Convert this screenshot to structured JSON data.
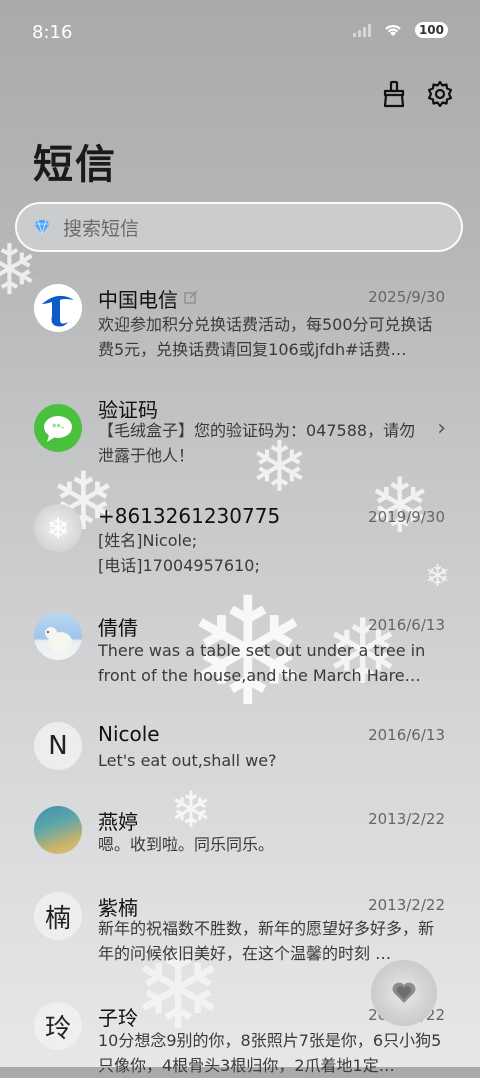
{
  "status": {
    "time": "8:16",
    "battery": "100"
  },
  "header": {
    "title": "短信"
  },
  "search": {
    "placeholder": "搜索短信"
  },
  "messages": [
    {
      "name": "中国电信",
      "date": "2025/9/30",
      "snippet": "欢迎参加积分兑换话费活动，每500分可兑换话费5元，兑换话费请回复106或jfdh#话费…",
      "avatar": "telecom-logo"
    },
    {
      "name": "验证码",
      "date": "",
      "snippet": "【毛绒盒子】您的验证码为：047588，请勿泄露于他人！",
      "avatar": "message-bubble"
    },
    {
      "name": "+8613261230775",
      "date": "2019/9/30",
      "snippet": "[姓名]Nicole;\n[电话]17004957610;",
      "avatar": "snowflake-photo"
    },
    {
      "name": "倩倩",
      "date": "2016/6/13",
      "snippet": "There was a table set out under a tree in front of the house,and the March Hare an…",
      "avatar": "polar-bear-photo"
    },
    {
      "name": "Nicole",
      "date": "2016/6/13",
      "snippet": "Let's eat out,shall we?",
      "avatar_letter": "N"
    },
    {
      "name": "燕婷",
      "date": "2013/2/22",
      "snippet": "嗯。收到啦。同乐同乐。",
      "avatar": "landscape-photo"
    },
    {
      "name": "紫楠",
      "date": "2013/2/22",
      "snippet": "新年的祝福数不胜数，新年的愿望好多好多，新年的问候依旧美好，在这个温馨的时刻 …",
      "avatar_letter": "楠"
    },
    {
      "name": "子玲",
      "date": "2013/2/22",
      "snippet": "10分想念9别的你，8张照片7张是你，6只小狗5只像你，4根骨头3根归你，2爪着地1定…",
      "avatar_letter": "玲"
    }
  ]
}
